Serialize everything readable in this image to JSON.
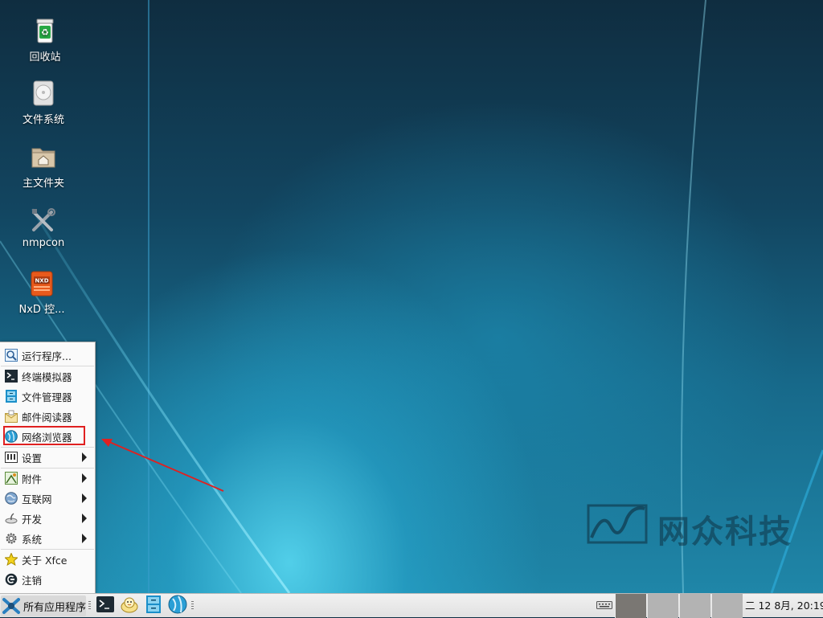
{
  "desktop": {
    "icons": [
      {
        "label": "回收站",
        "icon": "trash-icon"
      },
      {
        "label": "文件系统",
        "icon": "drive-icon"
      },
      {
        "label": "主文件夹",
        "icon": "home-folder-icon"
      },
      {
        "label": "nmpcon",
        "icon": "tools-icon"
      },
      {
        "label": "NxD 控...",
        "icon": "nxd-icon"
      }
    ],
    "watermark": "网众科技"
  },
  "menu": {
    "items": [
      {
        "label": "运行程序...",
        "icon": "run-icon",
        "submenu": false
      },
      {
        "label": "终端模拟器",
        "icon": "terminal-icon",
        "submenu": false
      },
      {
        "label": "文件管理器",
        "icon": "file-manager-icon",
        "submenu": false
      },
      {
        "label": "邮件阅读器",
        "icon": "mail-icon",
        "submenu": false
      },
      {
        "label": "网络浏览器",
        "icon": "browser-icon",
        "submenu": false,
        "highlighted": true
      },
      {
        "label": "设置",
        "icon": "settings-icon",
        "submenu": true
      },
      {
        "label": "附件",
        "icon": "accessories-icon",
        "submenu": true
      },
      {
        "label": "互联网",
        "icon": "internet-icon",
        "submenu": true
      },
      {
        "label": "开发",
        "icon": "development-icon",
        "submenu": true
      },
      {
        "label": "系统",
        "icon": "system-icon",
        "submenu": true
      },
      {
        "label": "关于 Xfce",
        "icon": "star-icon",
        "submenu": false
      },
      {
        "label": "注销",
        "icon": "logout-icon",
        "submenu": false
      }
    ],
    "highlight_color": "#e02020"
  },
  "taskbar": {
    "apps_menu_label": "所有应用程序",
    "launchers": [
      "terminal-icon",
      "mail-icon",
      "file-manager-icon",
      "browser-icon"
    ],
    "workspaces": [
      {
        "active": true
      },
      {
        "active": false
      },
      {
        "active": false
      },
      {
        "active": false
      }
    ],
    "clock": "二 12 8月, 20:19",
    "tray_icon": "keyboard-icon"
  },
  "colors": {
    "taskbar_bg": "#e6e6e6",
    "active_workspace": "#7a7773",
    "inactive_workspace": "#b3b3b3"
  }
}
